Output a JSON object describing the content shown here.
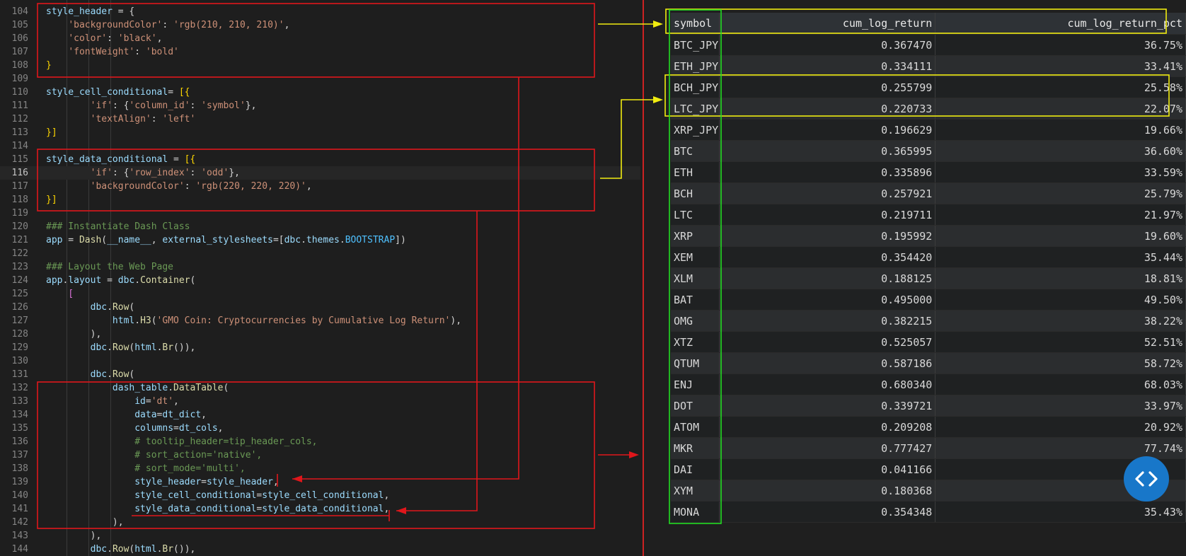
{
  "editor": {
    "active_line": 116,
    "lines": [
      {
        "n": 104,
        "t": [
          [
            "style_header",
            "v"
          ],
          [
            " = {",
            "p"
          ]
        ]
      },
      {
        "n": 105,
        "t": [
          [
            "    ",
            "p"
          ],
          [
            "'backgroundColor'",
            "s"
          ],
          [
            ": ",
            "p"
          ],
          [
            "'rgb(210, 210, 210)'",
            "s"
          ],
          [
            ",",
            "p"
          ]
        ]
      },
      {
        "n": 106,
        "t": [
          [
            "    ",
            "p"
          ],
          [
            "'color'",
            "s"
          ],
          [
            ": ",
            "p"
          ],
          [
            "'black'",
            "s"
          ],
          [
            ",",
            "p"
          ]
        ]
      },
      {
        "n": 107,
        "t": [
          [
            "    ",
            "p"
          ],
          [
            "'fontWeight'",
            "s"
          ],
          [
            ": ",
            "p"
          ],
          [
            "'bold'",
            "s"
          ]
        ]
      },
      {
        "n": 108,
        "t": [
          [
            "}",
            "y"
          ]
        ]
      },
      {
        "n": 109,
        "t": []
      },
      {
        "n": 110,
        "t": [
          [
            "style_cell_conditional",
            "v"
          ],
          [
            "= ",
            "p"
          ],
          [
            "[{",
            "y"
          ]
        ]
      },
      {
        "n": 111,
        "t": [
          [
            "        ",
            "p"
          ],
          [
            "'if'",
            "s"
          ],
          [
            ": {",
            "p"
          ],
          [
            "'column_id'",
            "s"
          ],
          [
            ": ",
            "p"
          ],
          [
            "'symbol'",
            "s"
          ],
          [
            "},",
            "p"
          ]
        ]
      },
      {
        "n": 112,
        "t": [
          [
            "        ",
            "p"
          ],
          [
            "'textAlign'",
            "s"
          ],
          [
            ": ",
            "p"
          ],
          [
            "'left'",
            "s"
          ]
        ]
      },
      {
        "n": 113,
        "t": [
          [
            "}]",
            "y"
          ]
        ]
      },
      {
        "n": 114,
        "t": []
      },
      {
        "n": 115,
        "t": [
          [
            "style_data_conditional",
            "v"
          ],
          [
            " = ",
            "p"
          ],
          [
            "[{",
            "y"
          ]
        ]
      },
      {
        "n": 116,
        "t": [
          [
            "        ",
            "p"
          ],
          [
            "'if'",
            "s"
          ],
          [
            ": {",
            "p"
          ],
          [
            "'row_index'",
            "s"
          ],
          [
            ": ",
            "p"
          ],
          [
            "'odd'",
            "s"
          ],
          [
            "},",
            "p"
          ]
        ]
      },
      {
        "n": 117,
        "t": [
          [
            "        ",
            "p"
          ],
          [
            "'backgroundColor'",
            "s"
          ],
          [
            ": ",
            "p"
          ],
          [
            "'rgb(220, 220, 220)'",
            "s"
          ],
          [
            ",",
            "p"
          ]
        ]
      },
      {
        "n": 118,
        "t": [
          [
            "}]",
            "y"
          ]
        ]
      },
      {
        "n": 119,
        "t": []
      },
      {
        "n": 120,
        "t": [
          [
            "### Instantiate Dash Class",
            "c"
          ]
        ]
      },
      {
        "n": 121,
        "t": [
          [
            "app",
            "v"
          ],
          [
            " = ",
            "p"
          ],
          [
            "Dash",
            "f"
          ],
          [
            "(",
            "p"
          ],
          [
            "__name__",
            "v"
          ],
          [
            ", ",
            "p"
          ],
          [
            "external_stylesheets",
            "v"
          ],
          [
            "=[",
            "p"
          ],
          [
            "dbc",
            "v"
          ],
          [
            ".",
            "p"
          ],
          [
            "themes",
            "v"
          ],
          [
            ".",
            "p"
          ],
          [
            "BOOTSTRAP",
            "k"
          ],
          [
            "])",
            "p"
          ]
        ]
      },
      {
        "n": 122,
        "t": []
      },
      {
        "n": 123,
        "t": [
          [
            "### Layout the Web Page",
            "c"
          ]
        ]
      },
      {
        "n": 124,
        "t": [
          [
            "app",
            "v"
          ],
          [
            ".",
            "p"
          ],
          [
            "layout",
            "v"
          ],
          [
            " = ",
            "p"
          ],
          [
            "dbc",
            "v"
          ],
          [
            ".",
            "p"
          ],
          [
            "Container",
            "f"
          ],
          [
            "(",
            "p"
          ]
        ]
      },
      {
        "n": 125,
        "t": [
          [
            "    [",
            "m"
          ]
        ]
      },
      {
        "n": 126,
        "t": [
          [
            "        ",
            "p"
          ],
          [
            "dbc",
            "v"
          ],
          [
            ".",
            "p"
          ],
          [
            "Row",
            "f"
          ],
          [
            "(",
            "p"
          ]
        ]
      },
      {
        "n": 127,
        "t": [
          [
            "            ",
            "p"
          ],
          [
            "html",
            "v"
          ],
          [
            ".",
            "p"
          ],
          [
            "H3",
            "f"
          ],
          [
            "(",
            "p"
          ],
          [
            "'GMO Coin: Cryptocurrencies by Cumulative Log Return'",
            "s"
          ],
          [
            "),",
            "p"
          ]
        ]
      },
      {
        "n": 128,
        "t": [
          [
            "        ),",
            "p"
          ]
        ]
      },
      {
        "n": 129,
        "t": [
          [
            "        ",
            "p"
          ],
          [
            "dbc",
            "v"
          ],
          [
            ".",
            "p"
          ],
          [
            "Row",
            "f"
          ],
          [
            "(",
            "p"
          ],
          [
            "html",
            "v"
          ],
          [
            ".",
            "p"
          ],
          [
            "Br",
            "f"
          ],
          [
            "()),",
            "p"
          ]
        ]
      },
      {
        "n": 130,
        "t": []
      },
      {
        "n": 131,
        "t": [
          [
            "        ",
            "p"
          ],
          [
            "dbc",
            "v"
          ],
          [
            ".",
            "p"
          ],
          [
            "Row",
            "f"
          ],
          [
            "(",
            "p"
          ]
        ]
      },
      {
        "n": 132,
        "t": [
          [
            "            ",
            "p"
          ],
          [
            "dash_table",
            "v"
          ],
          [
            ".",
            "p"
          ],
          [
            "DataTable",
            "f"
          ],
          [
            "(",
            "p"
          ]
        ]
      },
      {
        "n": 133,
        "t": [
          [
            "                ",
            "p"
          ],
          [
            "id",
            "v"
          ],
          [
            "=",
            "p"
          ],
          [
            "'dt'",
            "s"
          ],
          [
            ",",
            "p"
          ]
        ]
      },
      {
        "n": 134,
        "t": [
          [
            "                ",
            "p"
          ],
          [
            "data",
            "v"
          ],
          [
            "=",
            "p"
          ],
          [
            "dt_dict",
            "v"
          ],
          [
            ",",
            "p"
          ]
        ]
      },
      {
        "n": 135,
        "t": [
          [
            "                ",
            "p"
          ],
          [
            "columns",
            "v"
          ],
          [
            "=",
            "p"
          ],
          [
            "dt_cols",
            "v"
          ],
          [
            ",",
            "p"
          ]
        ]
      },
      {
        "n": 136,
        "t": [
          [
            "                # tooltip_header=tip_header_cols,",
            "c"
          ]
        ]
      },
      {
        "n": 137,
        "t": [
          [
            "                # sort_action='native',",
            "c"
          ]
        ]
      },
      {
        "n": 138,
        "t": [
          [
            "                # sort_mode='multi',",
            "c"
          ]
        ]
      },
      {
        "n": 139,
        "t": [
          [
            "                ",
            "p"
          ],
          [
            "style_header",
            "v"
          ],
          [
            "=",
            "p"
          ],
          [
            "style_header",
            "v"
          ],
          [
            ",",
            "p"
          ]
        ]
      },
      {
        "n": 140,
        "t": [
          [
            "                ",
            "p"
          ],
          [
            "style_cell_conditional",
            "v"
          ],
          [
            "=",
            "p"
          ],
          [
            "style_cell_conditional",
            "v"
          ],
          [
            ",",
            "p"
          ]
        ]
      },
      {
        "n": 141,
        "t": [
          [
            "                ",
            "p"
          ],
          [
            "style_data_conditional",
            "v"
          ],
          [
            "=",
            "p"
          ],
          [
            "style_data_conditional",
            "v"
          ],
          [
            ",",
            "p"
          ]
        ]
      },
      {
        "n": 142,
        "t": [
          [
            "            ),",
            "p"
          ]
        ]
      },
      {
        "n": 143,
        "t": [
          [
            "        ),",
            "p"
          ]
        ]
      },
      {
        "n": 144,
        "t": [
          [
            "        ",
            "p"
          ],
          [
            "dbc",
            "v"
          ],
          [
            ".",
            "p"
          ],
          [
            "Row",
            "f"
          ],
          [
            "(",
            "p"
          ],
          [
            "html",
            "v"
          ],
          [
            ".",
            "p"
          ],
          [
            "Br",
            "f"
          ],
          [
            "()),",
            "p"
          ]
        ]
      }
    ]
  },
  "syntax_colors": {
    "v": "#9cdcfe",
    "p": "#d4d4d4",
    "s": "#ce9178",
    "y": "#ffd700",
    "m": "#da70d6",
    "c": "#6a9955",
    "f": "#dcdcaa",
    "k": "#4fc1ff"
  },
  "annotation_colors": {
    "red": "#e0161b",
    "yellow": "#f0ec10",
    "green": "#22dd22"
  },
  "table": {
    "columns": [
      "symbol",
      "cum_log_return",
      "cum_log_return_pct"
    ],
    "rows": [
      [
        "BTC_JPY",
        "0.367470",
        "36.75%"
      ],
      [
        "ETH_JPY",
        "0.334111",
        "33.41%"
      ],
      [
        "BCH_JPY",
        "0.255799",
        "25.58%"
      ],
      [
        "LTC_JPY",
        "0.220733",
        "22.07%"
      ],
      [
        "XRP_JPY",
        "0.196629",
        "19.66%"
      ],
      [
        "BTC",
        "0.365995",
        "36.60%"
      ],
      [
        "ETH",
        "0.335896",
        "33.59%"
      ],
      [
        "BCH",
        "0.257921",
        "25.79%"
      ],
      [
        "LTC",
        "0.219711",
        "21.97%"
      ],
      [
        "XRP",
        "0.195992",
        "19.60%"
      ],
      [
        "XEM",
        "0.354420",
        "35.44%"
      ],
      [
        "XLM",
        "0.188125",
        "18.81%"
      ],
      [
        "BAT",
        "0.495000",
        "49.50%"
      ],
      [
        "OMG",
        "0.382215",
        "38.22%"
      ],
      [
        "XTZ",
        "0.525057",
        "52.51%"
      ],
      [
        "QTUM",
        "0.587186",
        "58.72%"
      ],
      [
        "ENJ",
        "0.680340",
        "68.03%"
      ],
      [
        "DOT",
        "0.339721",
        "33.97%"
      ],
      [
        "ATOM",
        "0.209208",
        "20.92%"
      ],
      [
        "MKR",
        "0.777427",
        "77.74%"
      ],
      [
        "DAI",
        "0.041166",
        ""
      ],
      [
        "XYM",
        "0.180368",
        ""
      ],
      [
        "MONA",
        "0.354348",
        "35.43%"
      ]
    ]
  },
  "fab": {
    "icon": "code-brackets-icon",
    "glyph": "< >"
  }
}
